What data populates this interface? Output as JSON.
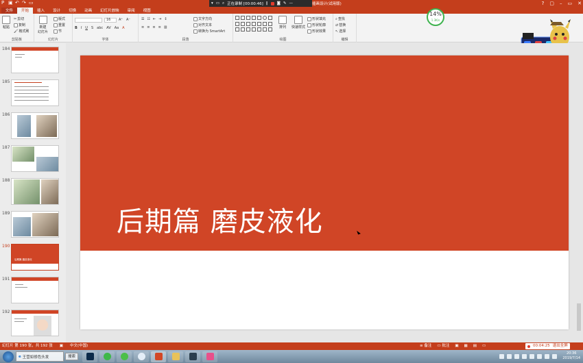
{
  "window": {
    "title": "插画设计(试用版)",
    "controls": [
      "?",
      "▢",
      "–",
      "▭",
      "✕"
    ]
  },
  "recorder": {
    "status": "正在录制 [00:00:46]",
    "elapsed": "00:04:25",
    "exit_label": "退出全屏"
  },
  "ribbon_tabs": [
    "文件",
    "开始",
    "插入",
    "设计",
    "切换",
    "动画",
    "幻灯片放映",
    "审阅",
    "视图"
  ],
  "ribbon": {
    "clipboard": {
      "paste": "粘贴",
      "cut": "剪切",
      "copy": "复制",
      "format_painter": "格式刷",
      "group": "剪贴板"
    },
    "slides": {
      "new_slide": "新建\n幻灯片",
      "layout": "版式",
      "reset": "重置",
      "section": "节",
      "group": "幻灯片"
    },
    "font": {
      "font_name": "",
      "font_size": "16",
      "group": "字体"
    },
    "paragraph": {
      "text_direction": "文字方向",
      "align_text": "对齐文本",
      "smartart": "转换为 SmartArt",
      "group": "段落"
    },
    "drawing": {
      "arrange": "排列",
      "quick_styles": "快速样式",
      "shape_fill": "形状填充",
      "shape_outline": "形状轮廓",
      "shape_effects": "形状效果",
      "group": "绘图"
    },
    "editing": {
      "find": "查找",
      "replace": "替换",
      "select": "选择",
      "group": "编辑"
    }
  },
  "sysmon": {
    "percent": "14%",
    "speed": "1.3K/s"
  },
  "slides": [
    {
      "num": "184",
      "kind": "text"
    },
    {
      "num": "185",
      "kind": "table"
    },
    {
      "num": "186",
      "kind": "photos"
    },
    {
      "num": "187",
      "kind": "photos2"
    },
    {
      "num": "188",
      "kind": "photos3"
    },
    {
      "num": "189",
      "kind": "photos4"
    },
    {
      "num": "190",
      "kind": "title",
      "label": "后期篇 磨皮液化",
      "selected": true
    },
    {
      "num": "191",
      "kind": "text2"
    },
    {
      "num": "192",
      "kind": "face"
    }
  ],
  "current_slide": {
    "title": "后期篇 磨皮液化"
  },
  "statusbar": {
    "slide_info": "幻灯片 第 190 张，共 192 张",
    "language": "中文(中国)",
    "notes": "备注",
    "comments": "批注"
  },
  "taskbar": {
    "ie_task": "王营如修色头发",
    "search": "搜索",
    "time": "20:36",
    "date": "2019/7/14"
  },
  "colors": {
    "accent": "#c43e1c",
    "slide_red": "#d04526"
  }
}
